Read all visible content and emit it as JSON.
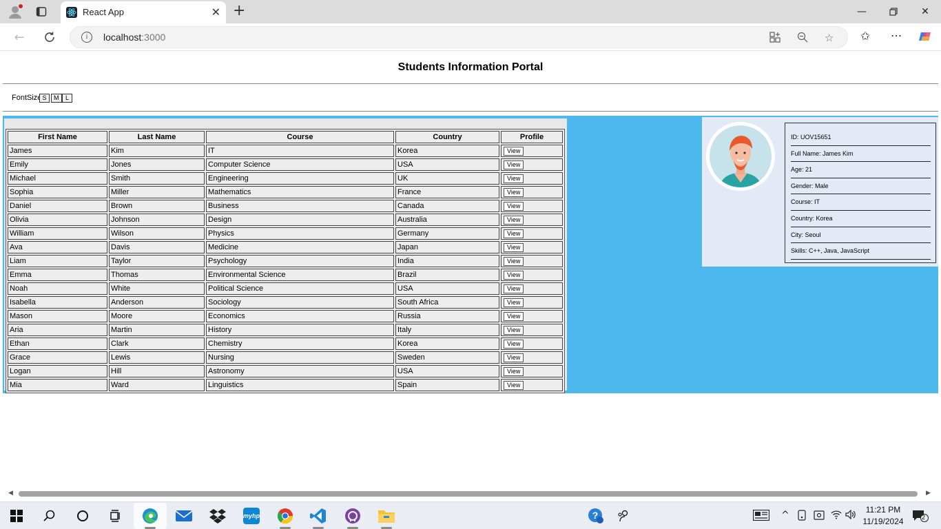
{
  "browser": {
    "tab_title": "React App",
    "url_host": "localhost",
    "url_port": ":3000"
  },
  "page": {
    "title": "Students Information Portal",
    "font_size_label": "FontSize",
    "font_size_buttons": [
      "S",
      "M",
      "L"
    ]
  },
  "table": {
    "headers": [
      "First Name",
      "Last Name",
      "Course",
      "Country",
      "Profile"
    ],
    "view_label": "View",
    "rows": [
      [
        "James",
        "Kim",
        "IT",
        "Korea"
      ],
      [
        "Emily",
        "Jones",
        "Computer Science",
        "USA"
      ],
      [
        "Michael",
        "Smith",
        "Engineering",
        "UK"
      ],
      [
        "Sophia",
        "Miller",
        "Mathematics",
        "France"
      ],
      [
        "Daniel",
        "Brown",
        "Business",
        "Canada"
      ],
      [
        "Olivia",
        "Johnson",
        "Design",
        "Australia"
      ],
      [
        "William",
        "Wilson",
        "Physics",
        "Germany"
      ],
      [
        "Ava",
        "Davis",
        "Medicine",
        "Japan"
      ],
      [
        "Liam",
        "Taylor",
        "Psychology",
        "India"
      ],
      [
        "Emma",
        "Thomas",
        "Environmental Science",
        "Brazil"
      ],
      [
        "Noah",
        "White",
        "Political Science",
        "USA"
      ],
      [
        "Isabella",
        "Anderson",
        "Sociology",
        "South Africa"
      ],
      [
        "Mason",
        "Moore",
        "Economics",
        "Russia"
      ],
      [
        "Aria",
        "Martin",
        "History",
        "Italy"
      ],
      [
        "Ethan",
        "Clark",
        "Chemistry",
        "Korea"
      ],
      [
        "Grace",
        "Lewis",
        "Nursing",
        "Sweden"
      ],
      [
        "Logan",
        "Hill",
        "Astronomy",
        "USA"
      ],
      [
        "Mia",
        "Ward",
        "Linguistics",
        "Spain"
      ]
    ]
  },
  "profile": {
    "id": "ID: UOV15651",
    "full_name": "Full Name: James Kim",
    "age": "Age: 21",
    "gender": "Gender: Male",
    "course": "Course: IT",
    "country": "Country: Korea",
    "city": "City: Seoul",
    "skills": "Skills: C++, Java, JavaScript"
  },
  "taskbar": {
    "time": "11:21 PM",
    "date": "11/19/2024",
    "notification_count": "2"
  },
  "colors": {
    "portal_background": "#4cb8ee",
    "profile_card_background": "#e3eaf6"
  }
}
